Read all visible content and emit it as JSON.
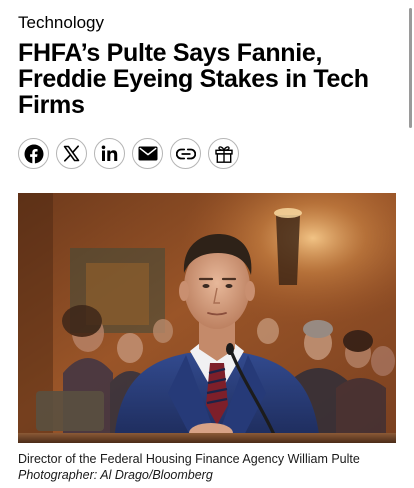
{
  "article": {
    "category": "Technology",
    "headline": "FHFA’s Pulte Says Fannie, Freddie Eyeing Stakes in Tech Firms"
  },
  "share": {
    "buttons": [
      {
        "name": "facebook",
        "icon": "facebook-icon"
      },
      {
        "name": "x",
        "icon": "x-icon"
      },
      {
        "name": "linkedin",
        "icon": "linkedin-icon"
      },
      {
        "name": "email",
        "icon": "mail-icon"
      },
      {
        "name": "copy-link",
        "icon": "link-icon"
      },
      {
        "name": "gift",
        "icon": "gift-icon"
      }
    ]
  },
  "photo": {
    "caption": "Director of the Federal Housing Finance Agency William Pulte",
    "credit": "Photographer: Al Drago/Bloomberg"
  },
  "colors": {
    "text": "#000000",
    "button_border": "#b5b5b5",
    "photo_wall": "#8a4a22",
    "suit": "#2b3f7a"
  }
}
